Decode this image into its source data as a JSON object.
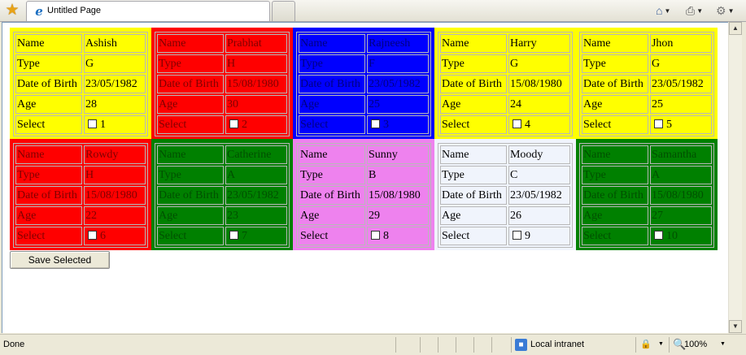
{
  "browser": {
    "tab_title": "Untitled Page",
    "status_text": "Done",
    "zone_label": "Local intranet",
    "zoom_label": "100%"
  },
  "labels": {
    "name": "Name",
    "type": "Type",
    "dob": "Date of Birth",
    "age": "Age",
    "select": "Select"
  },
  "cards": [
    {
      "name": "Ashish",
      "type": "G",
      "dob": "23/05/1982",
      "age": "28",
      "select": "1",
      "color": "yellow"
    },
    {
      "name": "Prabhat",
      "type": "H",
      "dob": "15/08/1980",
      "age": "30",
      "select": "2",
      "color": "red"
    },
    {
      "name": "Rajneesh",
      "type": "F",
      "dob": "23/05/1982",
      "age": "25",
      "select": "3",
      "color": "blue"
    },
    {
      "name": "Harry",
      "type": "G",
      "dob": "15/08/1980",
      "age": "24",
      "select": "4",
      "color": "yellow"
    },
    {
      "name": "Jhon",
      "type": "G",
      "dob": "23/05/1982",
      "age": "25",
      "select": "5",
      "color": "yellow"
    },
    {
      "name": "Rowdy",
      "type": "H",
      "dob": "15/08/1980",
      "age": "22",
      "select": "6",
      "color": "red"
    },
    {
      "name": "Catherine",
      "type": "A",
      "dob": "23/05/1982",
      "age": "23",
      "select": "7",
      "color": "green"
    },
    {
      "name": "Sunny",
      "type": "B",
      "dob": "15/08/1980",
      "age": "29",
      "select": "8",
      "color": "violet"
    },
    {
      "name": "Moody",
      "type": "C",
      "dob": "23/05/1982",
      "age": "26",
      "select": "9",
      "color": "white"
    },
    {
      "name": "Samantha",
      "type": "A",
      "dob": "15/08/1980",
      "age": "27",
      "select": "10",
      "color": "green"
    }
  ],
  "save_button_label": "Save Selected"
}
